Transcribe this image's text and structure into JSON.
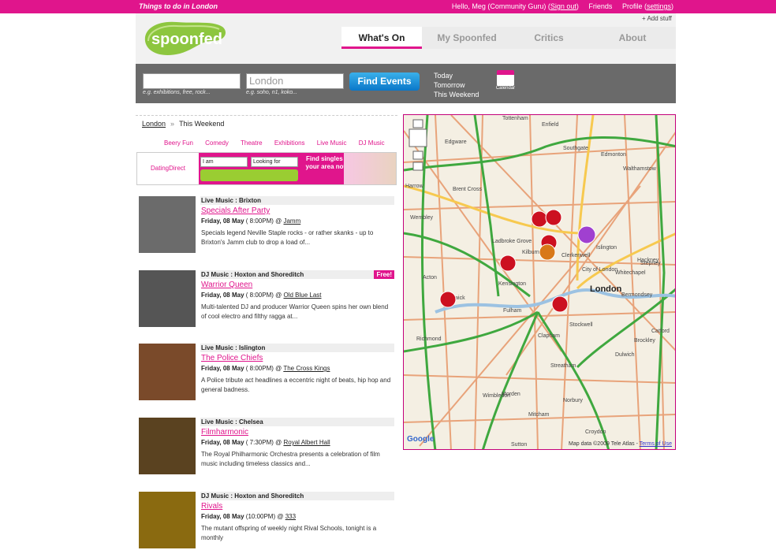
{
  "topbar": {
    "tagline": "Things to do in London",
    "greeting": "Hello, Meg (Community Guru)",
    "signout": "Sign out",
    "friends": "Friends",
    "profile": "Profile",
    "settings": "settings",
    "add_stuff": "+ Add stuff"
  },
  "logo": {
    "text": "spoonfed"
  },
  "nav": {
    "tabs": [
      "What's On",
      "My Spoonfed",
      "Critics",
      "About"
    ],
    "active": 0
  },
  "search": {
    "what_value": "",
    "what_hint": "e.g. exhibitions, free, rock...",
    "where_value": "London",
    "where_hint": "e.g. soho, n1, koko...",
    "button": "Find Events",
    "when": [
      "Today",
      "Tomorrow",
      "This Weekend"
    ],
    "calendar": "Calendar"
  },
  "breadcrumb": {
    "home": "London",
    "current": "This Weekend"
  },
  "categories": [
    "Beery Fun",
    "Comedy",
    "Theatre",
    "Exhibitions",
    "Live Music",
    "DJ Music"
  ],
  "ad": {
    "brand": "DatingDirect",
    "select1": "I am",
    "select2": "Looking for",
    "text": "Find singles in your area now!"
  },
  "events": [
    {
      "category": "Live Music : Brixton",
      "name": "Specials After Party",
      "date": "Friday, 08 May",
      "time": "( 8:00PM) @",
      "venue": "Jamm",
      "desc": "Specials legend Neville Staple rocks - or rather skanks - up to Brixton's Jamm club to drop a load of...",
      "free": "",
      "thumb": "#6b6b6b"
    },
    {
      "category": "DJ Music : Hoxton and Shoreditch",
      "name": "Warrior Queen",
      "date": "Friday, 08 May",
      "time": "( 8:00PM) @",
      "venue": "Old Blue Last",
      "desc": "Multi-talented DJ and producer Warrior Queen spins her own blend of cool electro and filthy ragga at...",
      "free": "Free!",
      "thumb": "#555"
    },
    {
      "category": "Live Music : Islington",
      "name": "The Police Chiefs",
      "date": "Friday, 08 May",
      "time": "( 8:00PM) @",
      "venue": "The Cross Kings",
      "desc": "A Police tribute act headlines a eccentric night of beats, hip hop and general badness.",
      "free": "",
      "thumb": "#7a4a2a"
    },
    {
      "category": "Live Music : Chelsea",
      "name": "Filmharmonic",
      "date": "Friday, 08 May",
      "time": "( 7:30PM) @",
      "venue": "Royal Albert Hall",
      "desc": "The Royal Philharmonic Orchestra presents a celebration of film music including timeless classics and...",
      "free": "",
      "thumb": "#5a4220"
    },
    {
      "category": "DJ Music : Hoxton and Shoreditch",
      "name": "Rivals",
      "date": "Friday, 08 May",
      "time": "(10:00PM) @",
      "venue": "333",
      "desc": "The mutant offspring of weekly night Rival Schools, tonight is a monthly",
      "free": "",
      "thumb": "#8a6a10"
    }
  ],
  "map": {
    "copyright": "Map data ©2009 Tele Atlas -",
    "terms": "Terms of Use",
    "places": [
      "Tottenham",
      "Edgware",
      "Enfield",
      "Southgate",
      "Edmonton",
      "Walthamstow",
      "Harrow",
      "Brent Cross",
      "Wembley",
      "Kilburn",
      "Islington",
      "Hackney",
      "Ladbroke Grove",
      "Clerkenwell",
      "Stepney",
      "Acton",
      "Kensington",
      "London",
      "City of London",
      "Whitechapel",
      "Chiswick",
      "Fulham",
      "Bermondsey",
      "Richmond",
      "Clapham",
      "Stockwell",
      "Brockley",
      "Dulwich",
      "Streatham",
      "Wimbledon",
      "Morden",
      "Mitcham",
      "Croydon",
      "Norbury",
      "Sutton",
      "Catford"
    ],
    "accent": "#cc1020"
  }
}
